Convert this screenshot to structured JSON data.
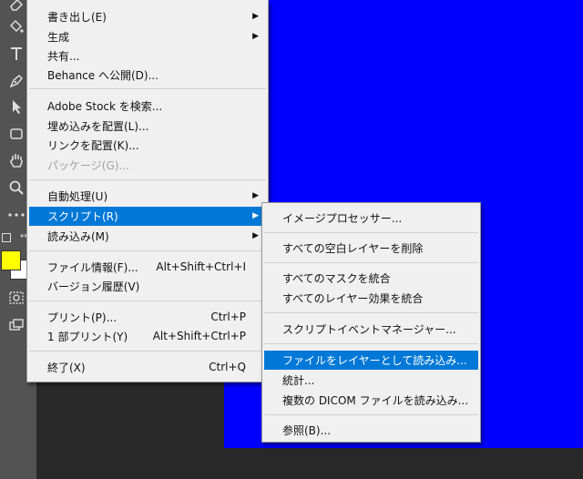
{
  "file_menu": {
    "items": [
      {
        "label": "書き出し(E)",
        "shortcut": "",
        "submenu": true
      },
      {
        "label": "生成",
        "shortcut": "",
        "submenu": true
      },
      {
        "label": "共有...",
        "shortcut": "",
        "submenu": false
      },
      {
        "label": "Behance へ公開(D)...",
        "shortcut": "",
        "submenu": false
      },
      {
        "label": "Adobe Stock を検索...",
        "shortcut": "",
        "submenu": false
      },
      {
        "label": "埋め込みを配置(L)...",
        "shortcut": "",
        "submenu": false
      },
      {
        "label": "リンクを配置(K)...",
        "shortcut": "",
        "submenu": false
      },
      {
        "label": "パッケージ(G)...",
        "shortcut": "",
        "submenu": false,
        "disabled": true
      },
      {
        "label": "自動処理(U)",
        "shortcut": "",
        "submenu": true
      },
      {
        "label": "スクリプト(R)",
        "shortcut": "",
        "submenu": true,
        "selected": true
      },
      {
        "label": "読み込み(M)",
        "shortcut": "",
        "submenu": true
      },
      {
        "label": "ファイル情報(F)...",
        "shortcut": "Alt+Shift+Ctrl+I",
        "submenu": false
      },
      {
        "label": "バージョン履歴(V)",
        "shortcut": "",
        "submenu": false
      },
      {
        "label": "プリント(P)...",
        "shortcut": "Ctrl+P",
        "submenu": false
      },
      {
        "label": "1 部プリント(Y)",
        "shortcut": "Alt+Shift+Ctrl+P",
        "submenu": false
      },
      {
        "label": "終了(X)",
        "shortcut": "Ctrl+Q",
        "submenu": false
      }
    ]
  },
  "script_menu": {
    "items": [
      {
        "label": "イメージプロセッサー..."
      },
      {
        "label": "すべての空白レイヤーを削除"
      },
      {
        "label": "すべてのマスクを統合"
      },
      {
        "label": "すべてのレイヤー効果を統合"
      },
      {
        "label": "スクリプトイベントマネージャー..."
      },
      {
        "label": "ファイルをレイヤーとして読み込み...",
        "selected": true
      },
      {
        "label": "統計..."
      },
      {
        "label": "複数の DICOM ファイルを読み込み..."
      },
      {
        "label": "参照(B)..."
      }
    ]
  },
  "arrow_glyph": "▶",
  "colors": {
    "menu_bg": "#f0f0f0",
    "highlight": "#0078d7",
    "canvas_blue": "#0000ff",
    "toolbar_bg": "#535353",
    "foreground_color": "#ffff00",
    "background_color": "#ffffff"
  },
  "toolbar_icons": [
    "eraser-icon",
    "pen-tool-icon",
    "type-tool-icon",
    "pen-icon",
    "selection-arrow-icon",
    "rectangle-tool-icon",
    "hand-tool-icon",
    "zoom-icon",
    "more-tools-icon",
    "color-swatches",
    "quick-mask-icon",
    "screen-mode-icon"
  ]
}
